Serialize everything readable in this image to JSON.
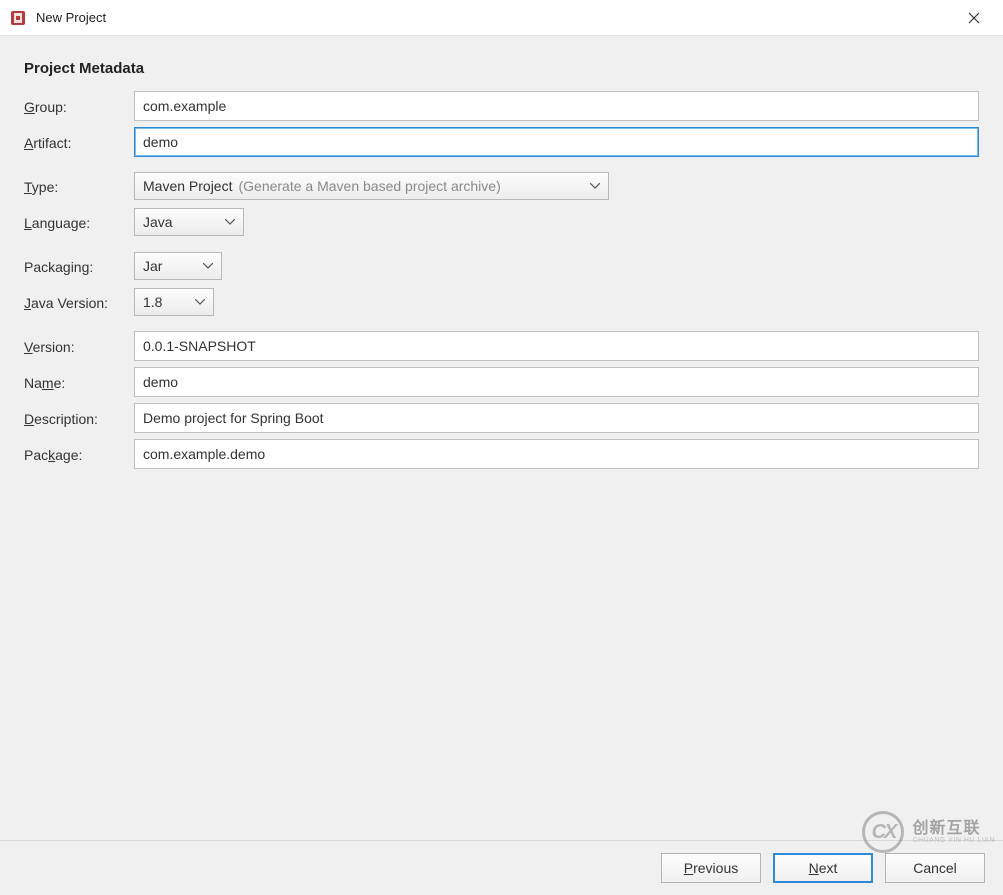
{
  "window": {
    "title": "New Project"
  },
  "section": {
    "title": "Project Metadata"
  },
  "labels": {
    "group": "Group:",
    "artifact": "Artifact:",
    "type": "Type:",
    "language": "Language:",
    "packaging": "Packaging:",
    "javaVersion": "Java Version:",
    "version": "Version:",
    "name": "Name:",
    "description": "Description:",
    "package": "Package:"
  },
  "fields": {
    "group": "com.example",
    "artifact": "demo",
    "type": {
      "value": "Maven Project",
      "hint": "(Generate a Maven based project archive)"
    },
    "language": "Java",
    "packaging": "Jar",
    "javaVersion": "1.8",
    "version": "0.0.1-SNAPSHOT",
    "name": "demo",
    "description": "Demo project for Spring Boot",
    "package": "com.example.demo"
  },
  "buttons": {
    "previous": "Previous",
    "next": "Next",
    "cancel": "Cancel"
  },
  "watermark": {
    "logo": "CX",
    "cn": "创新互联",
    "en": "CHUANG XIN HU LIAN"
  }
}
